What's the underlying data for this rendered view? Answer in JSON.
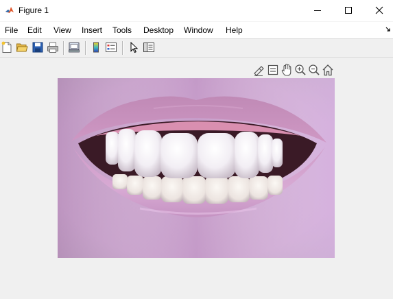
{
  "window": {
    "title": "Figure 1",
    "icon": "matlab-logo-icon"
  },
  "menu": {
    "items": [
      "File",
      "Edit",
      "View",
      "Insert",
      "Tools",
      "Desktop",
      "Window",
      "Help"
    ]
  },
  "toolbar": {
    "buttons": [
      "new-figure-icon",
      "open-file-icon",
      "save-icon",
      "print-icon",
      "link-plot-icon",
      "insert-colorbar-icon",
      "insert-legend-icon",
      "pointer-icon",
      "property-inspector-icon"
    ]
  },
  "axes_toolbar": {
    "buttons": [
      "brush-icon",
      "data-tips-icon",
      "pan-hand-icon",
      "zoom-in-icon",
      "zoom-out-icon",
      "home-icon"
    ]
  },
  "image": {
    "subject": "smiling-mouth-teeth-photo",
    "colors": {
      "skin": "#c9a0cc",
      "lips": "#c783b8",
      "teeth": "#f4eef2",
      "mouth_shadow": "#3a1a26"
    }
  }
}
